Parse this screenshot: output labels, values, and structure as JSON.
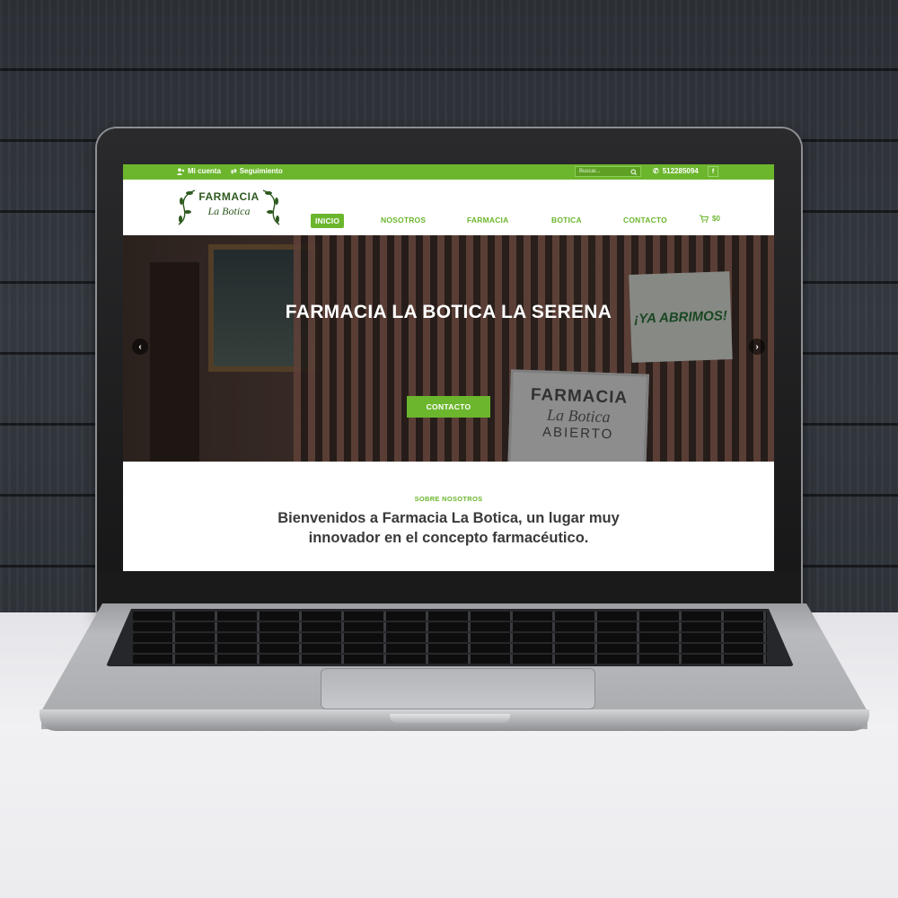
{
  "topbar": {
    "account_label": "Mi cuenta",
    "tracking_label": "Seguimiento",
    "search_placeholder": "Buscar...",
    "phone": "512285094",
    "facebook_icon": "f"
  },
  "logo": {
    "line1": "FARMACIA",
    "line2": "La Botica"
  },
  "nav": {
    "items": [
      "INICIO",
      "NOSOTROS",
      "FARMACIA",
      "BOTICA",
      "CONTACTO"
    ],
    "active": "INICIO",
    "cart_total": "$0"
  },
  "hero": {
    "title": "FARMACIA LA BOTICA LA SERENA",
    "button_label": "CONTACTO",
    "photo_banner_text": "¡YA ABRIMOS!",
    "photo_sign_line1": "FARMACIA",
    "photo_sign_line2": "La Botica",
    "photo_sign_line3": "ABIERTO"
  },
  "about": {
    "kicker": "SOBRE NOSOTROS",
    "title_line1": "Bienvenidos a Farmacia La Botica, un lugar muy",
    "title_line2": "innovador en el concepto farmacéutico."
  },
  "colors": {
    "brand_green": "#6cb62e",
    "logo_green": "#2e5a1f",
    "heading_text": "#3a3a3a"
  },
  "icons": [
    "user-icon",
    "tracking-arrows-icon",
    "search-icon",
    "phone-icon",
    "facebook-icon",
    "cart-icon",
    "chevron-left-icon",
    "chevron-right-icon"
  ]
}
